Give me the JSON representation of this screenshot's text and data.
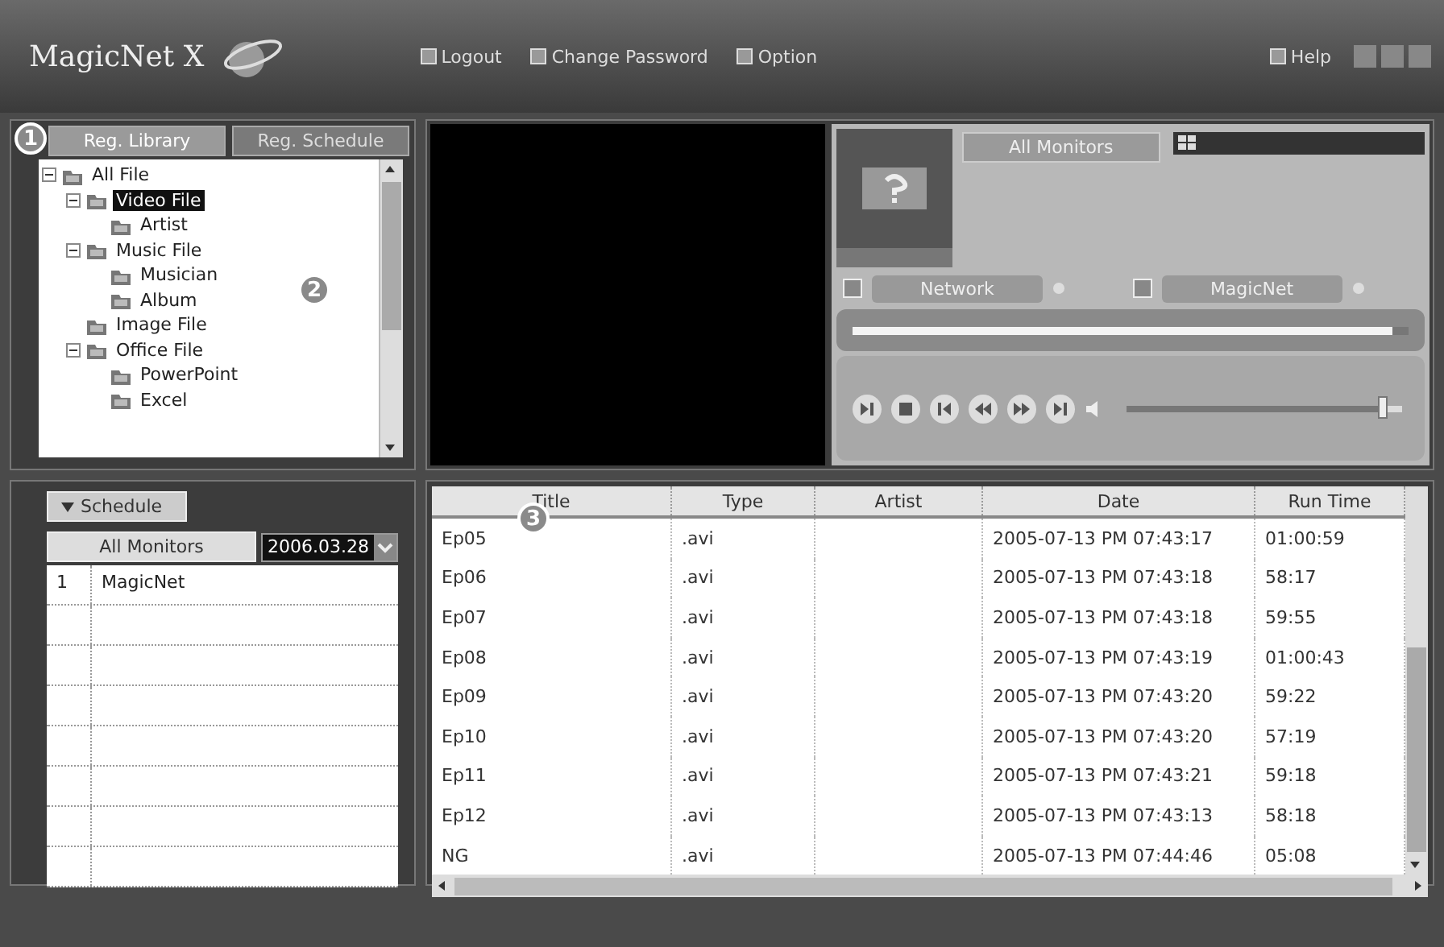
{
  "header": {
    "logo": "MagicNet X",
    "menu": [
      {
        "label": "Logout"
      },
      {
        "label": "Change Password"
      },
      {
        "label": "Option"
      },
      {
        "label": "Help"
      }
    ]
  },
  "callouts": [
    "1",
    "2",
    "3"
  ],
  "library": {
    "tabs": [
      {
        "label": "Reg. Library",
        "selected": true
      },
      {
        "label": "Reg. Schedule",
        "selected": false
      }
    ],
    "tree": [
      {
        "label": "All File",
        "selected": false,
        "expanded": true,
        "children": [
          {
            "label": "Video File",
            "selected": true,
            "expanded": true,
            "children": [
              {
                "label": "Artist",
                "selected": false
              }
            ]
          },
          {
            "label": "Music File",
            "selected": false,
            "expanded": true,
            "children": [
              {
                "label": "Musician",
                "selected": false
              },
              {
                "label": "Album",
                "selected": false
              }
            ]
          },
          {
            "label": "Image File",
            "selected": false
          },
          {
            "label": "Office File",
            "selected": false,
            "expanded": true,
            "children": [
              {
                "label": "PowerPoint",
                "selected": false
              },
              {
                "label": "Excel",
                "selected": false
              }
            ]
          }
        ]
      }
    ]
  },
  "player": {
    "monitor_button": "All Monitors",
    "status": [
      {
        "label": "Network"
      },
      {
        "label": "MagicNet"
      }
    ],
    "progress": {
      "level": 0.97
    },
    "volume": {
      "level": 0.93
    }
  },
  "schedule": {
    "tab": "Schedule",
    "monitor_button": "All Monitors",
    "date": "2006.03.28",
    "rows": [
      {
        "number": "1",
        "name": "MagicNet"
      }
    ]
  },
  "table": {
    "columns": [
      "Title",
      "Type",
      "Artist",
      "Date",
      "Run Time"
    ],
    "rows": [
      [
        "Ep05",
        ".avi",
        "",
        "2005-07-13 PM 07:43:17",
        "01:00:59"
      ],
      [
        "Ep06",
        ".avi",
        "",
        "2005-07-13 PM 07:43:18",
        "58:17"
      ],
      [
        "Ep07",
        ".avi",
        "",
        "2005-07-13 PM 07:43:18",
        "59:55"
      ],
      [
        "Ep08",
        ".avi",
        "",
        "2005-07-13 PM 07:43:19",
        "01:00:43"
      ],
      [
        "Ep09",
        ".avi",
        "",
        "2005-07-13 PM 07:43:20",
        "59:22"
      ],
      [
        "Ep10",
        ".avi",
        "",
        "2005-07-13 PM 07:43:20",
        "57:19"
      ],
      [
        "Ep11",
        ".avi",
        "",
        "2005-07-13 PM 07:43:21",
        "59:18"
      ],
      [
        "Ep12",
        ".avi",
        "",
        "2005-07-13 PM 07:43:13",
        "58:18"
      ],
      [
        "NG",
        ".avi",
        "",
        "2005-07-13 PM 07:44:46",
        "05:08"
      ]
    ]
  }
}
